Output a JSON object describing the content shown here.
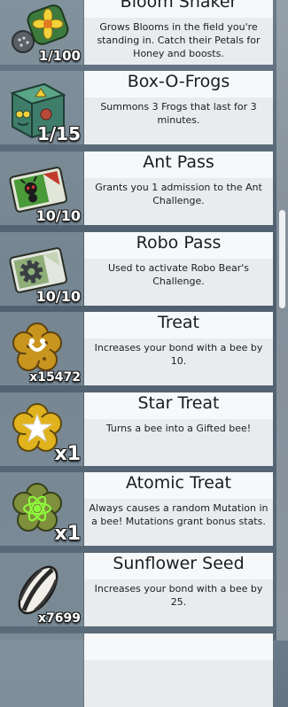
{
  "inventory": {
    "items": [
      {
        "name": "Bloom Shaker",
        "count": "1/100",
        "description": "Grows Blooms in the field you're standing in. Catch their Petals for Honey and boosts.",
        "icon": "bloom-shaker-icon"
      },
      {
        "name": "Box-O-Frogs",
        "count": "1/15",
        "description": "Summons 3 Frogs that last for 3 minutes.",
        "icon": "box-o-frogs-icon"
      },
      {
        "name": "Ant Pass",
        "count": "10/10",
        "description": "Grants you 1 admission to the Ant Challenge.",
        "icon": "ant-pass-icon"
      },
      {
        "name": "Robo Pass",
        "count": "10/10",
        "description": "Used to activate Robo Bear's Challenge.",
        "icon": "robo-pass-icon"
      },
      {
        "name": "Treat",
        "count": "x15472",
        "description": "Increases your bond with a bee by 10.",
        "icon": "treat-icon"
      },
      {
        "name": "Star Treat",
        "count": "x1",
        "description": "Turns a bee into a Gifted bee!",
        "icon": "star-treat-icon"
      },
      {
        "name": "Atomic Treat",
        "count": "x1",
        "description": "Always causes a random Mutation in a bee! Mutations grant bonus stats.",
        "icon": "atomic-treat-icon"
      },
      {
        "name": "Sunflower Seed",
        "count": "x7699",
        "description": "Increases your bond with a bee by 25.",
        "icon": "sunflower-seed-icon"
      }
    ]
  },
  "colors": {
    "title_bar": "#f6f8f9",
    "description_panel": "#e9ecee",
    "icon_panel": "#96a5af",
    "text": "#1a1d21",
    "count_text": "#ffffff"
  }
}
